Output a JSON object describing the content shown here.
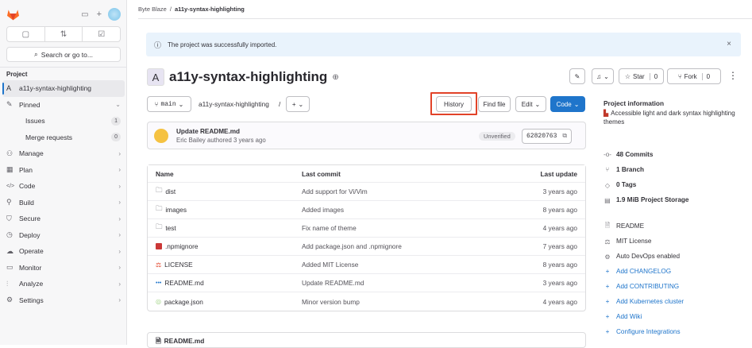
{
  "sidebar": {
    "search_label": "Search or go to...",
    "section_label": "Project",
    "project_item": "a11y-syntax-highlighting",
    "items": [
      {
        "label": "Pinned",
        "icon": "pin-icon"
      },
      {
        "label": "Issues",
        "badge": "1"
      },
      {
        "label": "Merge requests",
        "badge": "0"
      },
      {
        "label": "Manage",
        "icon": "people-icon"
      },
      {
        "label": "Plan",
        "icon": "calendar-icon"
      },
      {
        "label": "Code",
        "icon": "code-icon"
      },
      {
        "label": "Build",
        "icon": "rocket-icon"
      },
      {
        "label": "Secure",
        "icon": "shield-icon"
      },
      {
        "label": "Deploy",
        "icon": "deploy-icon"
      },
      {
        "label": "Operate",
        "icon": "cloud-icon"
      },
      {
        "label": "Monitor",
        "icon": "monitor-icon"
      },
      {
        "label": "Analyze",
        "icon": "chart-icon"
      },
      {
        "label": "Settings",
        "icon": "gear-icon"
      }
    ]
  },
  "breadcrumb": {
    "parent": "Byte Blaze",
    "sep": "/",
    "current": "a11y-syntax-highlighting"
  },
  "alert": {
    "text": "The project was successfully imported."
  },
  "project": {
    "avatar_letter": "A",
    "title": "a11y-syntax-highlighting"
  },
  "header_actions": {
    "star": "Star",
    "star_count": "0",
    "fork": "Fork",
    "fork_count": "0"
  },
  "toolbar": {
    "branch": "main",
    "path": "a11y-syntax-highlighting",
    "path_sep": "/",
    "plus": "+",
    "history": "History",
    "find_file": "Find file",
    "edit": "Edit",
    "code": "Code"
  },
  "last_commit": {
    "message": "Update README.md",
    "author_line": "Eric Bailey authored 3 years ago",
    "status": "Unverified",
    "sha": "62820763"
  },
  "files": {
    "headers": [
      "Name",
      "Last commit",
      "Last update"
    ],
    "rows": [
      {
        "name": "dist",
        "commit": "Add support for Vi/Vim",
        "updated": "3 years ago"
      },
      {
        "name": "images",
        "commit": "Added images",
        "updated": "8 years ago"
      },
      {
        "name": "test",
        "commit": "Fix name of theme",
        "updated": "4 years ago"
      },
      {
        "name": ".npmignore",
        "commit": "Add package.json and .npmignore",
        "updated": "7 years ago"
      },
      {
        "name": "LICENSE",
        "commit": "Added MIT License",
        "updated": "8 years ago"
      },
      {
        "name": "README.md",
        "commit": "Update README.md",
        "updated": "3 years ago"
      },
      {
        "name": "package.json",
        "commit": "Minor version bump",
        "updated": "4 years ago"
      }
    ]
  },
  "readme_header": "README.md",
  "project_info": {
    "title": "Project information",
    "description": "Accessible light and dark syntax highlighting themes",
    "stats": [
      {
        "label": "48 Commits",
        "icon": "commit-icon"
      },
      {
        "label": "1 Branch",
        "icon": "branch-icon"
      },
      {
        "label": "0 Tags",
        "icon": "tag-icon"
      },
      {
        "label": "1.9 MiB Project Storage",
        "icon": "storage-icon"
      }
    ],
    "links": [
      {
        "label": "README",
        "icon": "file-icon"
      },
      {
        "label": "MIT License",
        "icon": "scale-icon"
      },
      {
        "label": "Auto DevOps enabled",
        "icon": "settings-icon"
      }
    ],
    "adds": [
      "Add CHANGELOG",
      "Add CONTRIBUTING",
      "Add Kubernetes cluster",
      "Add Wiki",
      "Configure Integrations"
    ]
  },
  "colors": {
    "accent": "#1f75cb",
    "highlight": "#e24329",
    "gitlab_orange": "#fc6d26"
  }
}
